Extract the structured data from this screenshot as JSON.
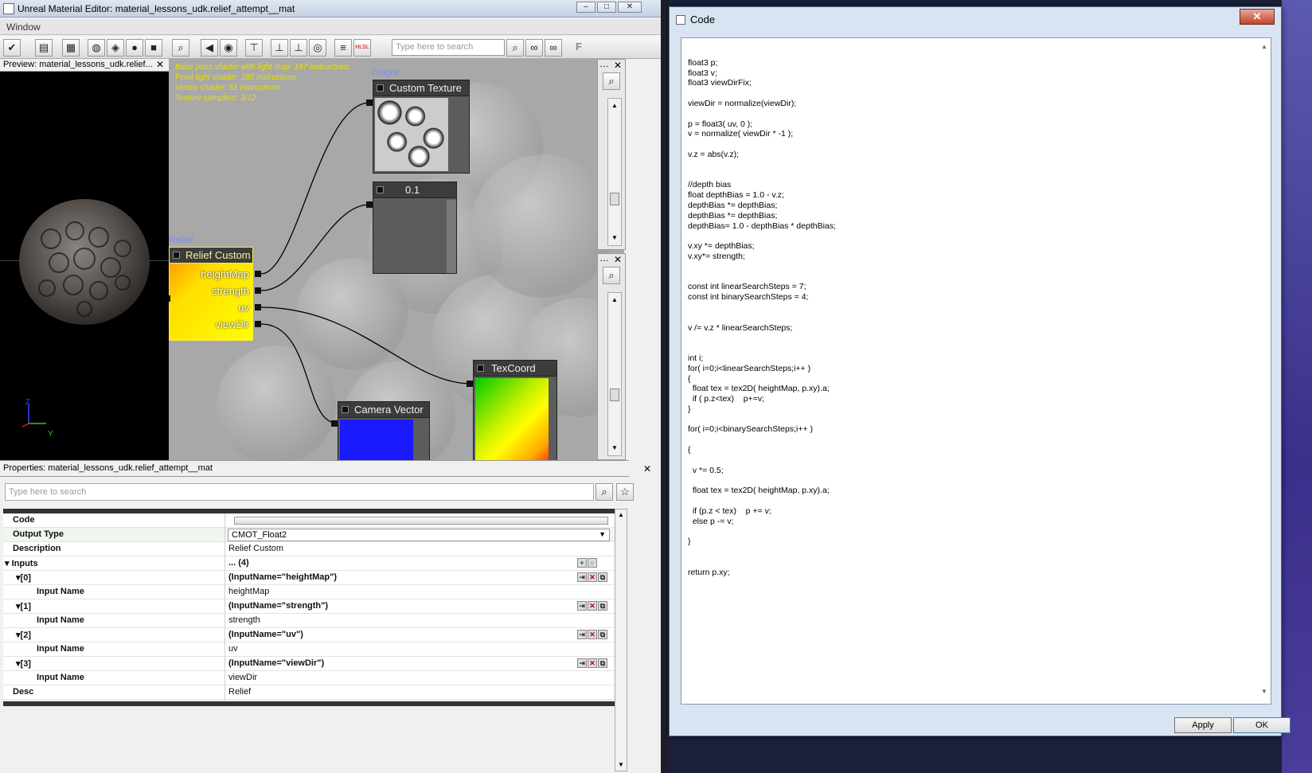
{
  "editor": {
    "title": "Unreal Material Editor: material_lessons_udk.relief_attempt__mat",
    "menu": "Window",
    "search_placeholder": "Type here to search"
  },
  "preview": {
    "header": "Preview: material_lessons_udk.relief...",
    "axis_z": "Z",
    "axis_y": "Y"
  },
  "graph": {
    "stats": [
      "Base pass shader with light map: 187 instructions",
      "Point light shader: 185 instructions",
      "Vertex shader: 51 instructions",
      "Texture samplers: 3/12"
    ],
    "nodes": {
      "custom_texture": {
        "caption": "height",
        "title": "Custom Texture"
      },
      "constant": {
        "title": "0.1"
      },
      "relief": {
        "caption": "Relief",
        "title": "Relief Custom",
        "ports": [
          "heightMap",
          "strength",
          "uv",
          "viewDir"
        ]
      },
      "texcoord": {
        "title": "TexCoord"
      },
      "camera_vector": {
        "title": "Camera Vector"
      }
    }
  },
  "properties": {
    "header": "Properties: material_lessons_udk.relief_attempt__mat",
    "search_placeholder": "Type here to search",
    "rows": {
      "code": {
        "key": "Code",
        "value": ""
      },
      "output_type": {
        "key": "Output Type",
        "value": "CMOT_Float2"
      },
      "description": {
        "key": "Description",
        "value": "Relief Custom"
      },
      "inputs": {
        "key": "Inputs",
        "value": "... (4)"
      },
      "in0": {
        "key": "[0]",
        "value": "(InputName=\"heightMap\")"
      },
      "in0_name": {
        "key": "Input Name",
        "value": "heightMap"
      },
      "in1": {
        "key": "[1]",
        "value": "(InputName=\"strength\")"
      },
      "in1_name": {
        "key": "Input Name",
        "value": "strength"
      },
      "in2": {
        "key": "[2]",
        "value": "(InputName=\"uv\")"
      },
      "in2_name": {
        "key": "Input Name",
        "value": "uv"
      },
      "in3": {
        "key": "[3]",
        "value": "(InputName=\"viewDir\")"
      },
      "in3_name": {
        "key": "Input Name",
        "value": "viewDir"
      },
      "desc": {
        "key": "Desc",
        "value": "Relief"
      }
    }
  },
  "code_dialog": {
    "title": "Code",
    "close": "✕",
    "code": "\nfloat3 p;\nfloat3 v;\nfloat3 viewDirFix;\n\nviewDir = normalize(viewDir);\n\np = float3( uv, 0 );\nv = normalize( viewDir * -1 );\n\nv.z = abs(v.z);\n\n\n//depth bias\nfloat depthBias = 1.0 - v.z;\ndepthBias *= depthBias;\ndepthBias *= depthBias;\ndepthBias= 1.0 - depthBias * depthBias;\n\nv.xy *= depthBias;\nv.xy*= strength;\n\n\nconst int linearSearchSteps = 7;\nconst int binarySearchSteps = 4;\n\n\nv /= v.z * linearSearchSteps;\n\n\nint i;\nfor( i=0;i<linearSearchSteps;i++ )\n{\n  float tex = tex2D( heightMap, p.xy).a;\n  if ( p.z<tex)    p+=v;\n}\n\nfor( i=0;i<binarySearchSteps;i++ )\n\n{\n\n  v *= 0.5;\n\n  float tex = tex2D( heightMap, p.xy).a;\n\n  if (p.z < tex)    p += v;\n  else p -= v;\n\n}\n\n\nreturn p.xy;",
    "apply": "Apply",
    "ok": "OK"
  },
  "colors": {
    "graph_bg": "#a8a8a8",
    "stats_text": "#e8e000",
    "selected_outline": "#ffee44",
    "camera_vector": "#1a1aff"
  },
  "icons": [
    "check-icon",
    "grid-icon",
    "sphere-icon",
    "back-arrow-icon",
    "search-icon",
    "binoculars-icon",
    "close-icon"
  ]
}
